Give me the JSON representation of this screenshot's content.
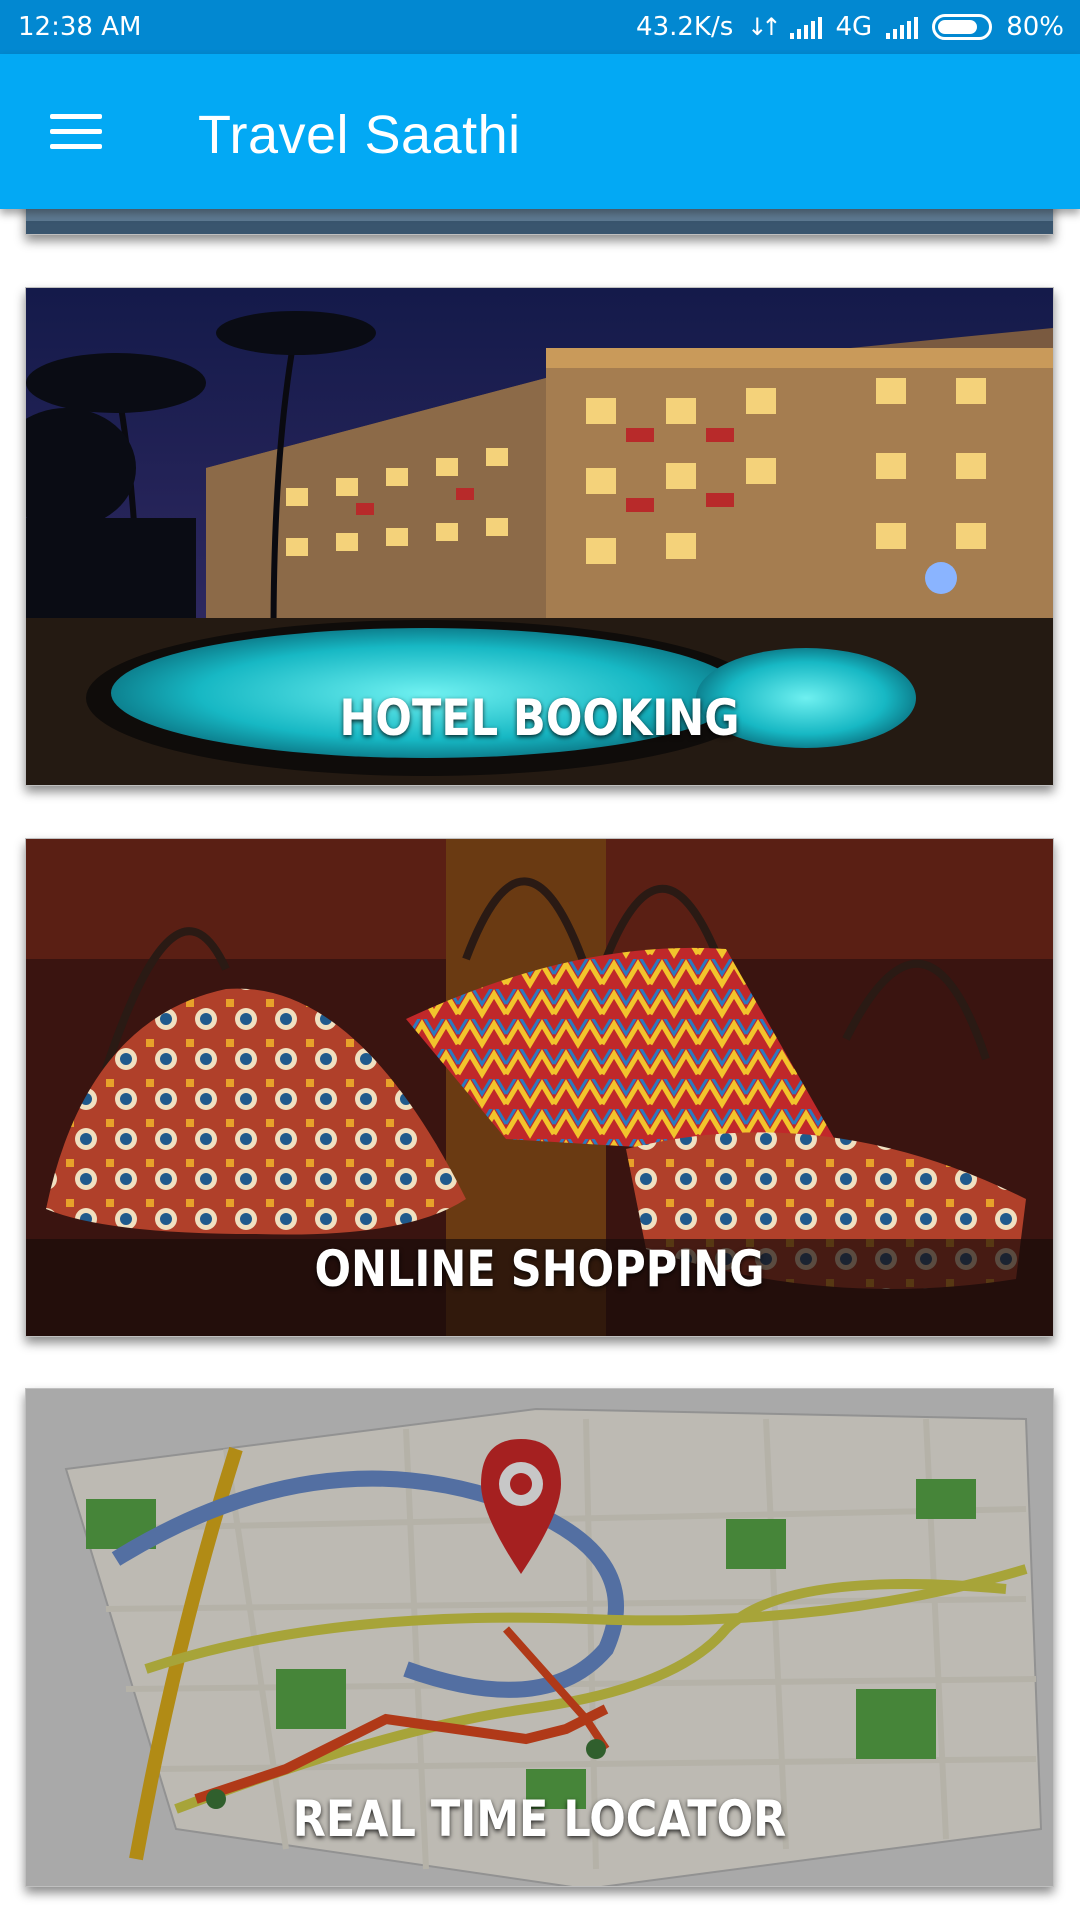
{
  "status_bar": {
    "time": "12:38 AM",
    "speed": "43.2K/s",
    "network": "4G",
    "battery": "80%",
    "battery_level": 0.8
  },
  "app_bar": {
    "menu_icon": "hamburger-menu-icon",
    "title": "Travel Saathi"
  },
  "cards": [
    {
      "label": ""
    },
    {
      "label": "HOTEL BOOKING"
    },
    {
      "label": "ONLINE SHOPPING"
    },
    {
      "label": "REAL TIME LOCATOR"
    }
  ],
  "colors": {
    "status_bar": "#0288d1",
    "app_bar": "#03a9f4"
  }
}
